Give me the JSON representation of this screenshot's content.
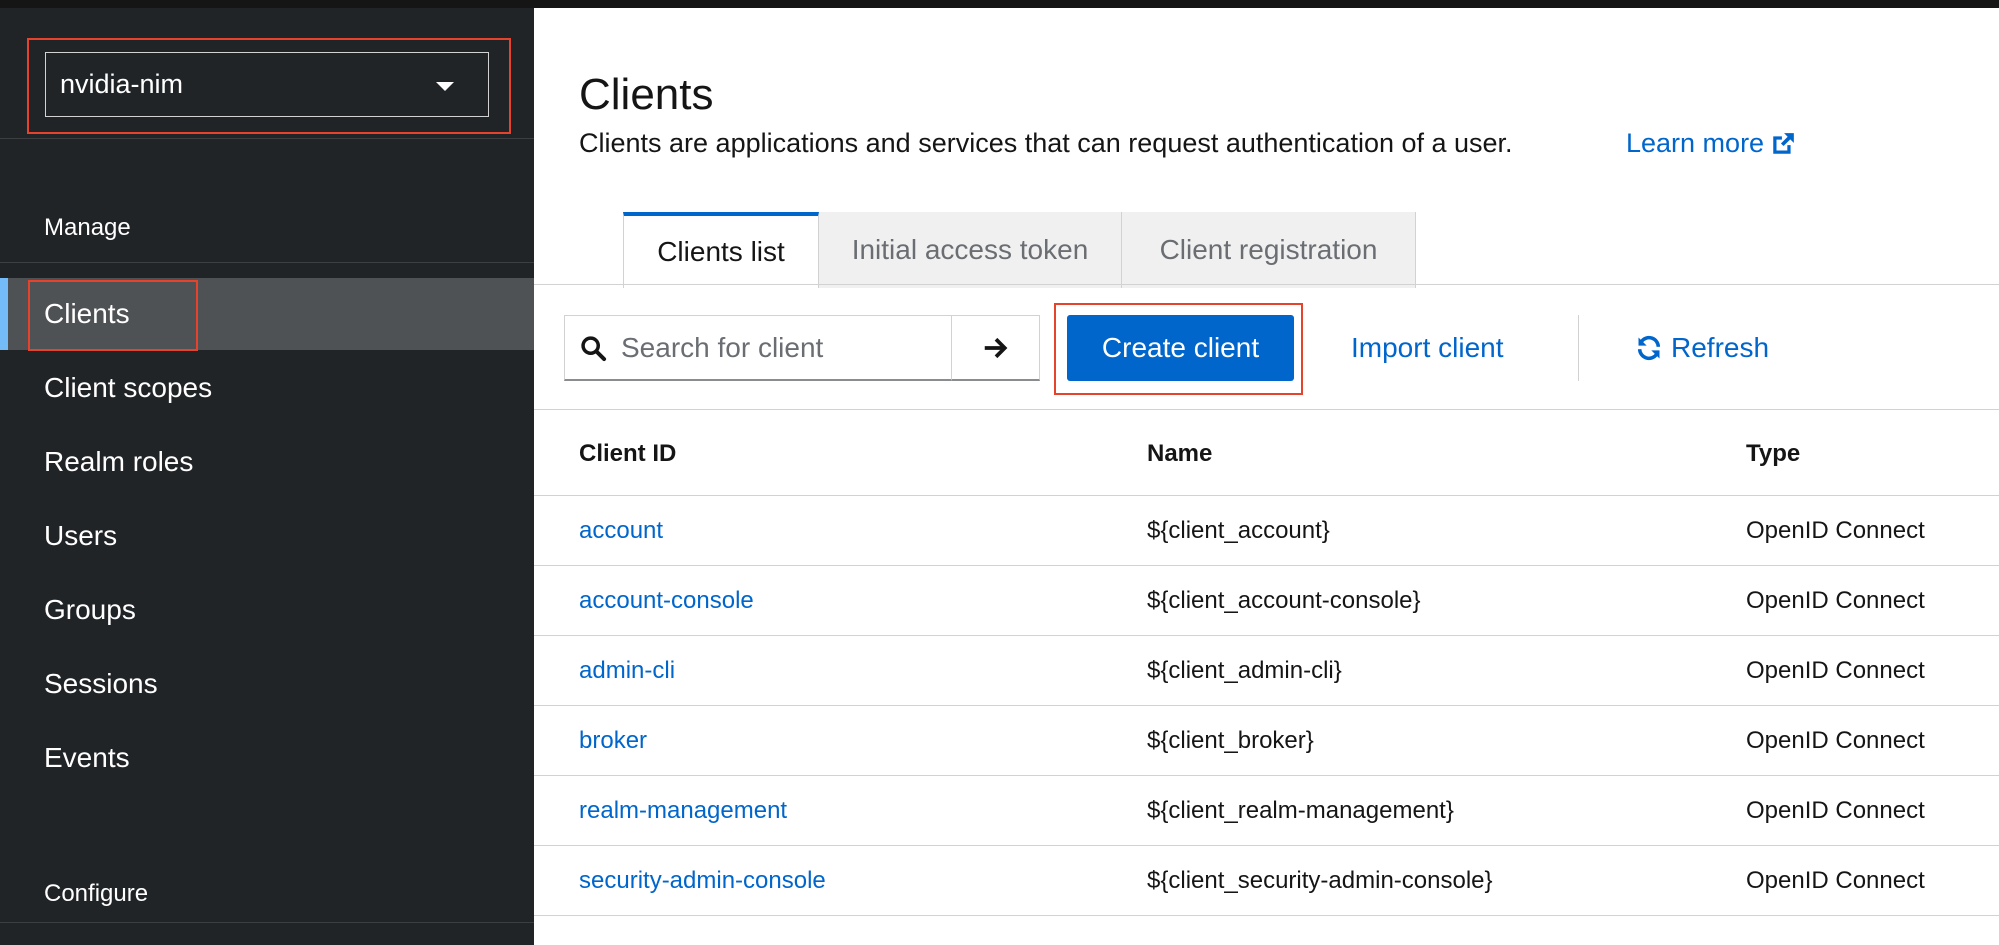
{
  "realm": {
    "name": "nvidia-nim"
  },
  "sidebar": {
    "sections": [
      {
        "title": "Manage"
      },
      {
        "title": "Configure"
      }
    ],
    "items": [
      {
        "label": "Clients"
      },
      {
        "label": "Client scopes"
      },
      {
        "label": "Realm roles"
      },
      {
        "label": "Users"
      },
      {
        "label": "Groups"
      },
      {
        "label": "Sessions"
      },
      {
        "label": "Events"
      }
    ]
  },
  "page": {
    "title": "Clients",
    "description": "Clients are applications and services that can request authentication of a user.",
    "learn_more": "Learn more"
  },
  "tabs": [
    {
      "label": "Clients list"
    },
    {
      "label": "Initial access token"
    },
    {
      "label": "Client registration"
    }
  ],
  "toolbar": {
    "search_placeholder": "Search for client",
    "create_label": "Create client",
    "import_label": "Import client",
    "refresh_label": "Refresh"
  },
  "table": {
    "headers": [
      "Client ID",
      "Name",
      "Type"
    ],
    "rows": [
      {
        "client_id": "account",
        "name": "${client_account}",
        "type": "OpenID Connect"
      },
      {
        "client_id": "account-console",
        "name": "${client_account-console}",
        "type": "OpenID Connect"
      },
      {
        "client_id": "admin-cli",
        "name": "${client_admin-cli}",
        "type": "OpenID Connect"
      },
      {
        "client_id": "broker",
        "name": "${client_broker}",
        "type": "OpenID Connect"
      },
      {
        "client_id": "realm-management",
        "name": "${client_realm-management}",
        "type": "OpenID Connect"
      },
      {
        "client_id": "security-admin-console",
        "name": "${client_security-admin-console}",
        "type": "OpenID Connect"
      }
    ]
  },
  "colors": {
    "sidebar_bg": "#212427",
    "active_item_bg": "#4f5255",
    "accent": "#0066cc",
    "highlight_box": "#e5432b"
  }
}
